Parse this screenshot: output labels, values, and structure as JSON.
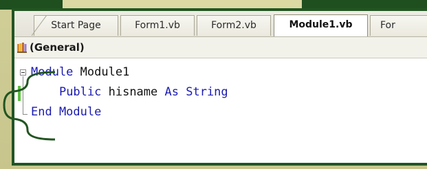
{
  "tabs": [
    {
      "label": "Start Page",
      "active": false
    },
    {
      "label": "Form1.vb",
      "active": false
    },
    {
      "label": "Form2.vb",
      "active": false
    },
    {
      "label": "Module1.vb",
      "active": true
    },
    {
      "label": "For",
      "active": false
    }
  ],
  "combo": {
    "label": "(General)",
    "icon": "class-members-icon"
  },
  "code": {
    "line1": {
      "kw": "Module",
      "rest": " Module1"
    },
    "line2": {
      "indent": "    ",
      "kw1": "Public",
      "mid": " hisname ",
      "kw2": "As",
      "sp": " ",
      "kw3": "String"
    },
    "line3": {
      "kw": "End Module"
    }
  },
  "colors": {
    "frame": "#225522",
    "slide_bg": "#c9c78f",
    "keyword": "#1b1bb0",
    "change_bar": "#5bbf3d"
  }
}
